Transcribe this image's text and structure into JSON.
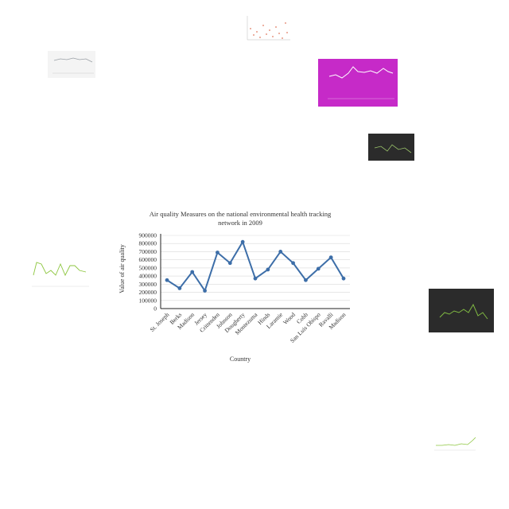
{
  "main_chart": {
    "title": "Air quality Measures on the national environmental health tracking network in 2009",
    "xlabel": "Country",
    "ylabel": "Value of air quality",
    "chart_data": {
      "type": "line",
      "title": "Air quality Measures on the national environmental health tracking network in 2009",
      "xlabel": "Country",
      "ylabel": "Value of air quality",
      "categories": [
        "St. Joseph",
        "Berks",
        "Madison",
        "Jersey",
        "Crittenden",
        "Johnson",
        "Dougherty",
        "Montezuma",
        "Hinds",
        "Laramie",
        "Wood",
        "Cobb",
        "San Luis Obispo",
        "Ravalli",
        "Madison"
      ],
      "values": [
        350000,
        250000,
        450000,
        220000,
        690000,
        560000,
        820000,
        370000,
        480000,
        700000,
        560000,
        350000,
        490000,
        630000,
        370000
      ],
      "yticks": [
        0,
        100000,
        200000,
        300000,
        400000,
        500000,
        600000,
        700000,
        800000,
        900000
      ],
      "ylim": [
        0,
        900000
      ],
      "grid": true,
      "color": "#3d6ea8"
    }
  },
  "thumbnails": [
    {
      "name": "scatter-thumbnail",
      "type": "scatter",
      "bg": "#ffffff",
      "line": "#e07a5f"
    },
    {
      "name": "gray-line-thumbnail-top-left",
      "type": "line",
      "bg": "#f2f2f2",
      "line": "#9aa0a6"
    },
    {
      "name": "magenta-line-thumbnail",
      "type": "line",
      "bg": "#c62ac8",
      "line": "#ffffff"
    },
    {
      "name": "dark-line-thumbnail-small",
      "type": "line",
      "bg": "#2b2b2b",
      "line": "#9bc46b"
    },
    {
      "name": "green-line-thumbnail-left",
      "type": "line",
      "bg": "#ffffff",
      "line": "#8dc63f"
    },
    {
      "name": "dark-line-thumbnail-right",
      "type": "line",
      "bg": "#2b2b2b",
      "line": "#7fb842"
    },
    {
      "name": "light-line-thumbnail-bottom-right",
      "type": "line",
      "bg": "#ffffff",
      "line": "#8dc63f"
    }
  ]
}
